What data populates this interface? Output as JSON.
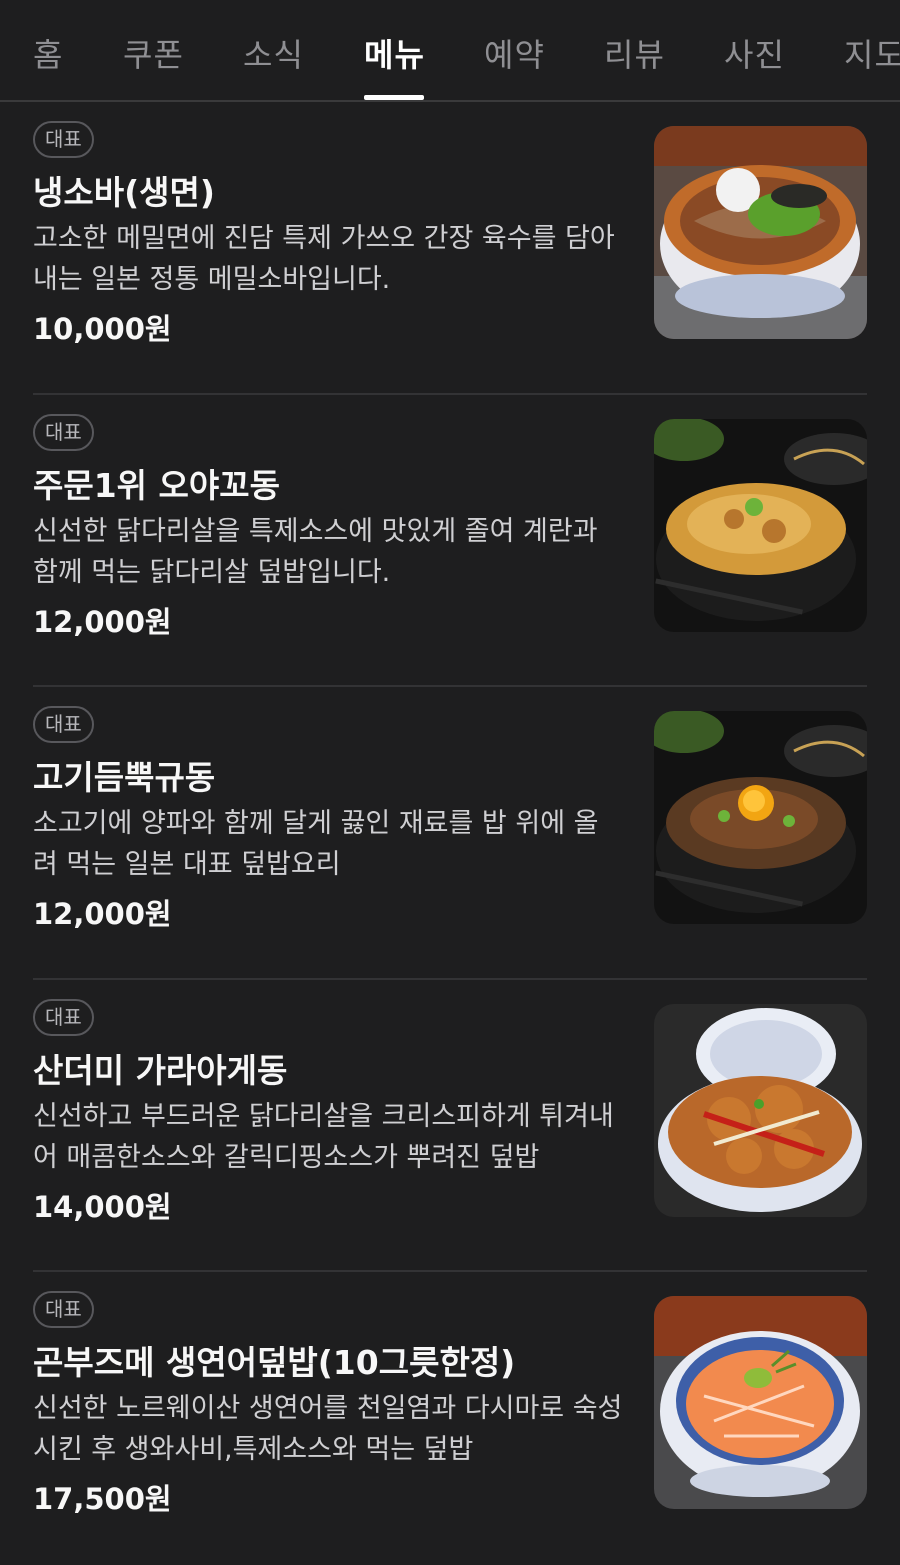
{
  "tabs": [
    {
      "label": "홈",
      "active": false
    },
    {
      "label": "쿠폰",
      "active": false
    },
    {
      "label": "소식",
      "active": false
    },
    {
      "label": "메뉴",
      "active": true
    },
    {
      "label": "예약",
      "active": false
    },
    {
      "label": "리뷰",
      "active": false
    },
    {
      "label": "사진",
      "active": false
    },
    {
      "label": "지도",
      "active": false
    }
  ],
  "menu": {
    "items": [
      {
        "badge": "대표",
        "name": "냉소바(생면)",
        "description": "고소한 메밀면에 진담 특제 가쓰오 간장 육수를 담아내는 일본 정통 메밀소바입니다.",
        "price": "10,000원",
        "photo_icon": "soba-bowl-photo"
      },
      {
        "badge": "대표",
        "name": "주문1위 오야꼬동",
        "description": "신선한 닭다리살을 특제소스에 맛있게 졸여 계란과 함께 먹는 닭다리살 덮밥입니다.",
        "price": "12,000원",
        "photo_icon": "oyakodon-bowl-photo"
      },
      {
        "badge": "대표",
        "name": "고기듬뿍규동",
        "description": "소고기에 양파와 함께 달게 끓인 재료를 밥 위에 올려 먹는 일본 대표 덮밥요리",
        "price": "12,000원",
        "photo_icon": "gyudon-bowl-photo"
      },
      {
        "badge": "대표",
        "name": "산더미 가라아게동",
        "description": "신선하고 부드러운 닭다리살을 크리스피하게 튀겨내어 매콤한소스와 갈릭디핑소스가 뿌려진 덮밥",
        "price": "14,000원",
        "photo_icon": "karaage-bowl-photo"
      },
      {
        "badge": "대표",
        "name": "곤부즈메 생연어덮밥(10그릇한정)",
        "description": "신선한 노르웨이산 생연어를 천일염과 다시마로 숙성시킨 후 생와사비,특제소스와 먹는 덮밥",
        "price": "17,500원",
        "photo_icon": "salmon-bowl-photo"
      }
    ]
  }
}
